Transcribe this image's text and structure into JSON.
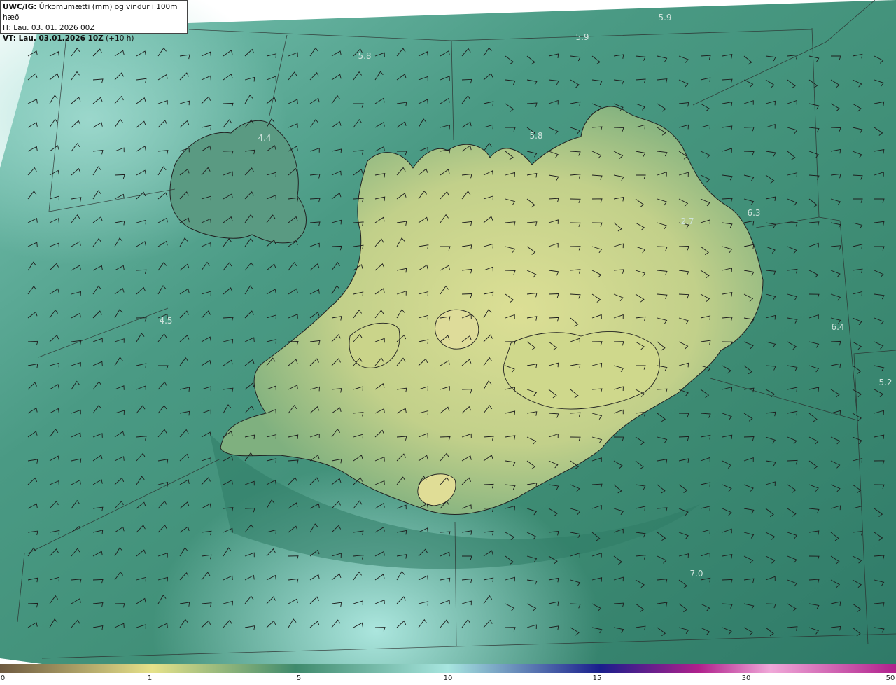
{
  "header": {
    "model": "UWC/IG:",
    "title": "Úrkomumætti (mm) og vindur i 100m hæð",
    "it_line": "IT: Lau. 03. 01. 2026 00Z",
    "vt_label": "VT: Lau. 03.01.2026 10Z",
    "vt_offset": "(+10 h)"
  },
  "map_values": [
    {
      "id": "v1",
      "text": "5.9"
    },
    {
      "id": "v2",
      "text": "5.9"
    },
    {
      "id": "v3",
      "text": "5.8"
    },
    {
      "id": "v4",
      "text": "4.4"
    },
    {
      "id": "v5",
      "text": "5.8"
    },
    {
      "id": "v6",
      "text": "6.3"
    },
    {
      "id": "v7",
      "text": "2.7"
    },
    {
      "id": "v8",
      "text": "4.5"
    },
    {
      "id": "v9",
      "text": "6.4"
    },
    {
      "id": "v10",
      "text": "5.2"
    },
    {
      "id": "v11",
      "text": "7.0"
    }
  ],
  "colorbar": {
    "ticks": [
      "0",
      "1",
      "5",
      "10",
      "15",
      "30",
      "50"
    ],
    "colors": {
      "low": "#6e5a40",
      "yellow": "#e6e28a",
      "green": "#3f8a6c",
      "cyan": "#a8e6e0",
      "blue": "#1a1e8c",
      "magenta": "#b0208c",
      "pink": "#f0a8d8"
    }
  },
  "colors": {
    "sea": "#3f8f7e",
    "sea_light": "#8fd5c8",
    "land": "#c9d48a",
    "land_dark": "#6aa276"
  }
}
